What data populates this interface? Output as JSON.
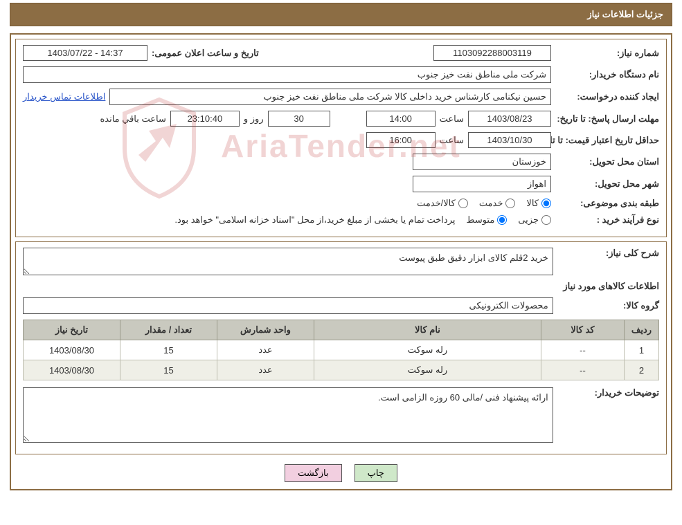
{
  "titlebar": "جزئیات اطلاعات نیاز",
  "labels": {
    "need_no": "شماره نیاز:",
    "ann_datetime": "تاریخ و ساعت اعلان عمومی:",
    "buyer_org": "نام دستگاه خریدار:",
    "requester": "ایجاد کننده درخواست:",
    "contact_link": "اطلاعات تماس خریدار",
    "resp_deadline": "مهلت ارسال پاسخ:",
    "to_date": "تا تاریخ:",
    "hour": "ساعت",
    "days_and": "روز و",
    "remaining": "ساعت باقي مانده",
    "price_valid": "حداقل تاریخ اعتبار قیمت:",
    "deliv_prov": "استان محل تحویل:",
    "deliv_city": "شهر محل تحویل:",
    "topic_class": "طبقه بندی موضوعی:",
    "goods": "کالا",
    "service": "خدمت",
    "goods_service": "کالا/خدمت",
    "buy_type": "نوع فرآیند خرید :",
    "partial": "جزیی",
    "medium": "متوسط",
    "pay_note": "پرداخت تمام یا بخشی از مبلغ خرید،از محل \"اسناد خزانه اسلامی\" خواهد بود.",
    "need_desc": "شرح کلی نیاز:",
    "goods_info": "اطلاعات کالاهای مورد نیاز",
    "goods_group": "گروه کالا:",
    "buyer_notes": "توضیحات خریدار:",
    "print": "چاپ",
    "back": "بازگشت"
  },
  "fields": {
    "need_no": "1103092288003119",
    "ann_datetime": "14:37 - 1403/07/22",
    "buyer_org": "شرکت ملی مناطق نفت خیز جنوب",
    "requester": "حسین  نیکنامی  کارشناس خرید داخلی کالا شرکت ملی مناطق نفت خیز جنوب",
    "resp_date": "1403/08/23",
    "resp_time": "14:00",
    "resp_days": "30",
    "resp_remain": "23:10:40",
    "price_date": "1403/10/30",
    "price_time": "16:00",
    "province": "خوزستان",
    "city": "اهواز",
    "need_desc_text": "خرید 2قلم کالای ابزار دقیق طبق پیوست",
    "goods_group_text": "محصولات الکترونیکی",
    "buyer_notes_text": "ارائه پیشنهاد فنی /مالی 60 روزه الزامی است."
  },
  "table": {
    "headers": {
      "idx": "ردیف",
      "code": "کد کالا",
      "name": "نام کالا",
      "unit": "واحد شمارش",
      "qty": "تعداد / مقدار",
      "date": "تاریخ نیاز"
    },
    "rows": [
      {
        "idx": "1",
        "code": "--",
        "name": "رله سوکت",
        "unit": "عدد",
        "qty": "15",
        "date": "1403/08/30"
      },
      {
        "idx": "2",
        "code": "--",
        "name": "رله سوکت",
        "unit": "عدد",
        "qty": "15",
        "date": "1403/08/30"
      }
    ]
  },
  "watermark": "AriaTender.net"
}
